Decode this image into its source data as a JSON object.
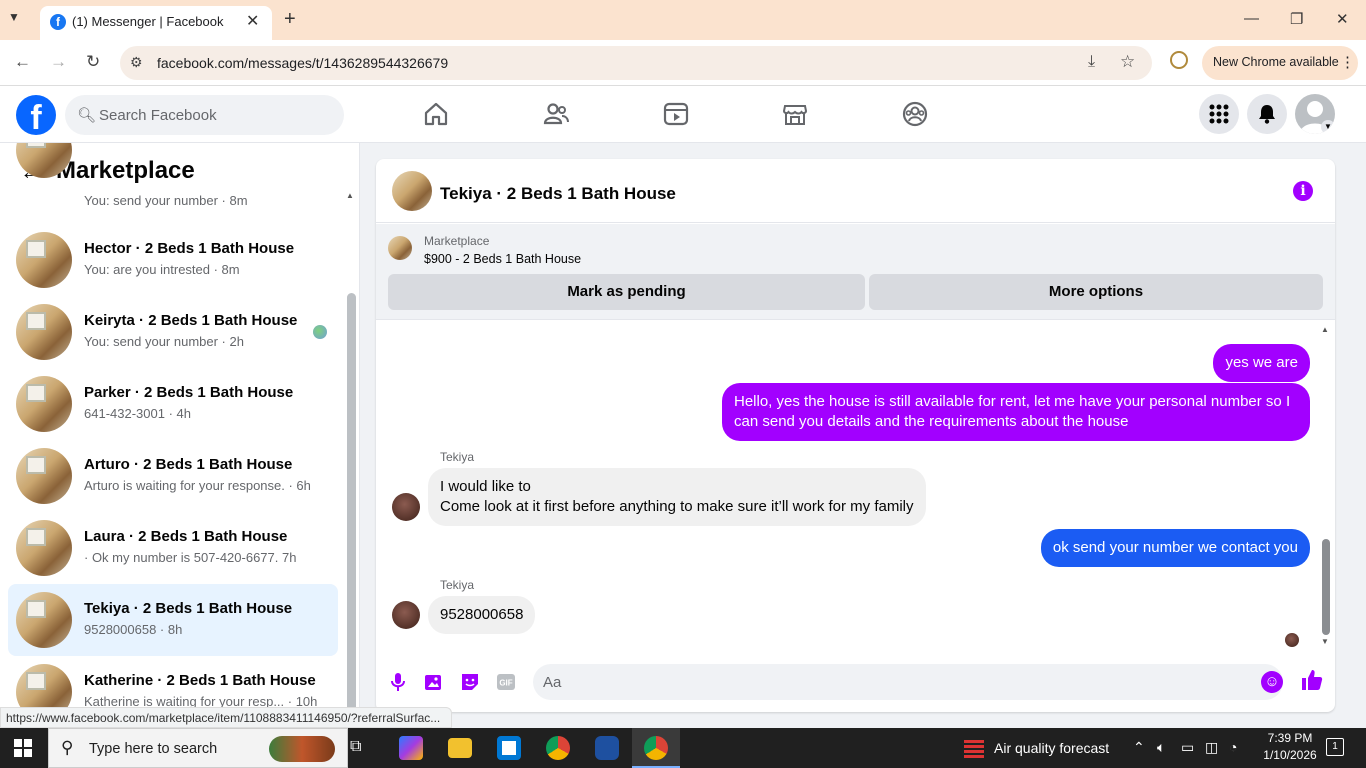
{
  "browser": {
    "tab_title": "(1) Messenger | Facebook",
    "tab_close": "✕",
    "new_tab": "+",
    "url": "facebook.com/messages/t/1436289544326679",
    "chrome_update": "New Chrome available",
    "status_url": "https://www.facebook.com/marketplace/item/1108883411146950/?referralSurfac..."
  },
  "header": {
    "search_placeholder": "Search Facebook",
    "logo_letter": "f"
  },
  "sidebar": {
    "title": "Marketplace",
    "conversations": [
      {
        "name": "",
        "snippet": "You: send your number · 8m"
      },
      {
        "name": "Hector · 2 Beds 1 Bath House",
        "snippet": "You: are you intrested · 8m"
      },
      {
        "name": "Keiryta · 2 Beds 1 Bath House",
        "snippet": "You: send your number · 2h"
      },
      {
        "name": "Parker · 2 Beds 1 Bath House",
        "snippet": "641-432-3001 · 4h"
      },
      {
        "name": "Arturo · 2 Beds 1 Bath House",
        "snippet": "Arturo is waiting for your response. · 6h"
      },
      {
        "name": "Laura · 2 Beds 1 Bath House",
        "snippet": "· Ok my number is 507-420-6677. 7h"
      },
      {
        "name": "Tekiya · 2 Beds 1 Bath House",
        "snippet": "9528000658 · 8h"
      },
      {
        "name": "Katherine · 2 Beds 1 Bath House",
        "snippet": "Katherine is waiting for your resp... · 10h"
      }
    ]
  },
  "chat": {
    "title": "Tekiya · 2 Beds 1 Bath House",
    "info_icon": "i",
    "marketplace_label": "Marketplace",
    "listing": "$900 - 2 Beds 1 Bath House",
    "mark_pending": "Mark as pending",
    "more_options": "More options",
    "messages": [
      {
        "from": "me",
        "text": "yes we are"
      },
      {
        "from": "me",
        "text": "Hello, yes the house is still available for rent, let me have your personal number so I can send you details and the requirements about the house"
      },
      {
        "from": "Tekiya",
        "text": "I would like to\nCome look at it first before anything to make sure it’ll work for my family"
      },
      {
        "from": "me",
        "text": "ok send your number we contact you"
      },
      {
        "from": "Tekiya",
        "text": "9528000658"
      }
    ],
    "composer_placeholder": "Aa"
  },
  "taskbar": {
    "search_text": "Type here to search",
    "weather": "Air quality forecast",
    "time": "7:39 PM",
    "date": "1/10/2026",
    "notifications": "1"
  }
}
